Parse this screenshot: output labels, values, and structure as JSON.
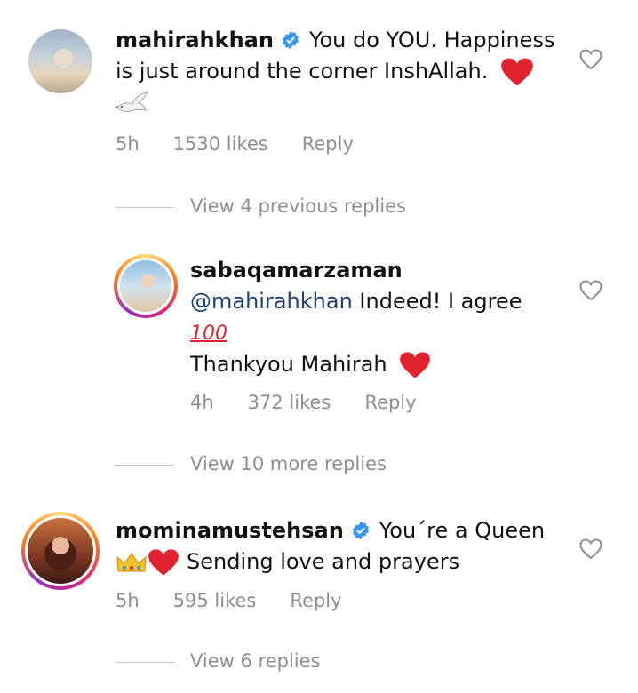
{
  "comments": [
    {
      "username": "mahirahkhan",
      "verified": true,
      "text_line1": "You do YOU. Happiness",
      "text_line2": "is just around the corner InshAllah.",
      "time": "5h",
      "likes": "1530 likes",
      "reply": "Reply"
    },
    {
      "username": "sabaqamarzaman",
      "mention": "@mahirahkhan",
      "text_line1": "Indeed! I agree",
      "emoji_100": "100",
      "text_line2": "Thankyou Mahirah",
      "time": "4h",
      "likes": "372 likes",
      "reply": "Reply"
    },
    {
      "username": "mominamustehsan",
      "verified": true,
      "text_line1": "You´re a Queen",
      "text_line2": "Sending love and prayers",
      "time": "5h",
      "likes": "595 likes",
      "reply": "Reply"
    }
  ],
  "view_links": [
    "View 4 previous replies",
    "View 10 more replies",
    "View 6 replies"
  ],
  "colors": {
    "verified_blue": "#3897f0",
    "heart_red": "#e0232e",
    "mention": "#1d3f72",
    "meta_gray": "#8e8e8e"
  },
  "icons": [
    "verified-badge-icon",
    "heart-outline-icon",
    "red-heart-emoji",
    "dove-emoji",
    "hundred-points-emoji",
    "crown-emoji"
  ]
}
